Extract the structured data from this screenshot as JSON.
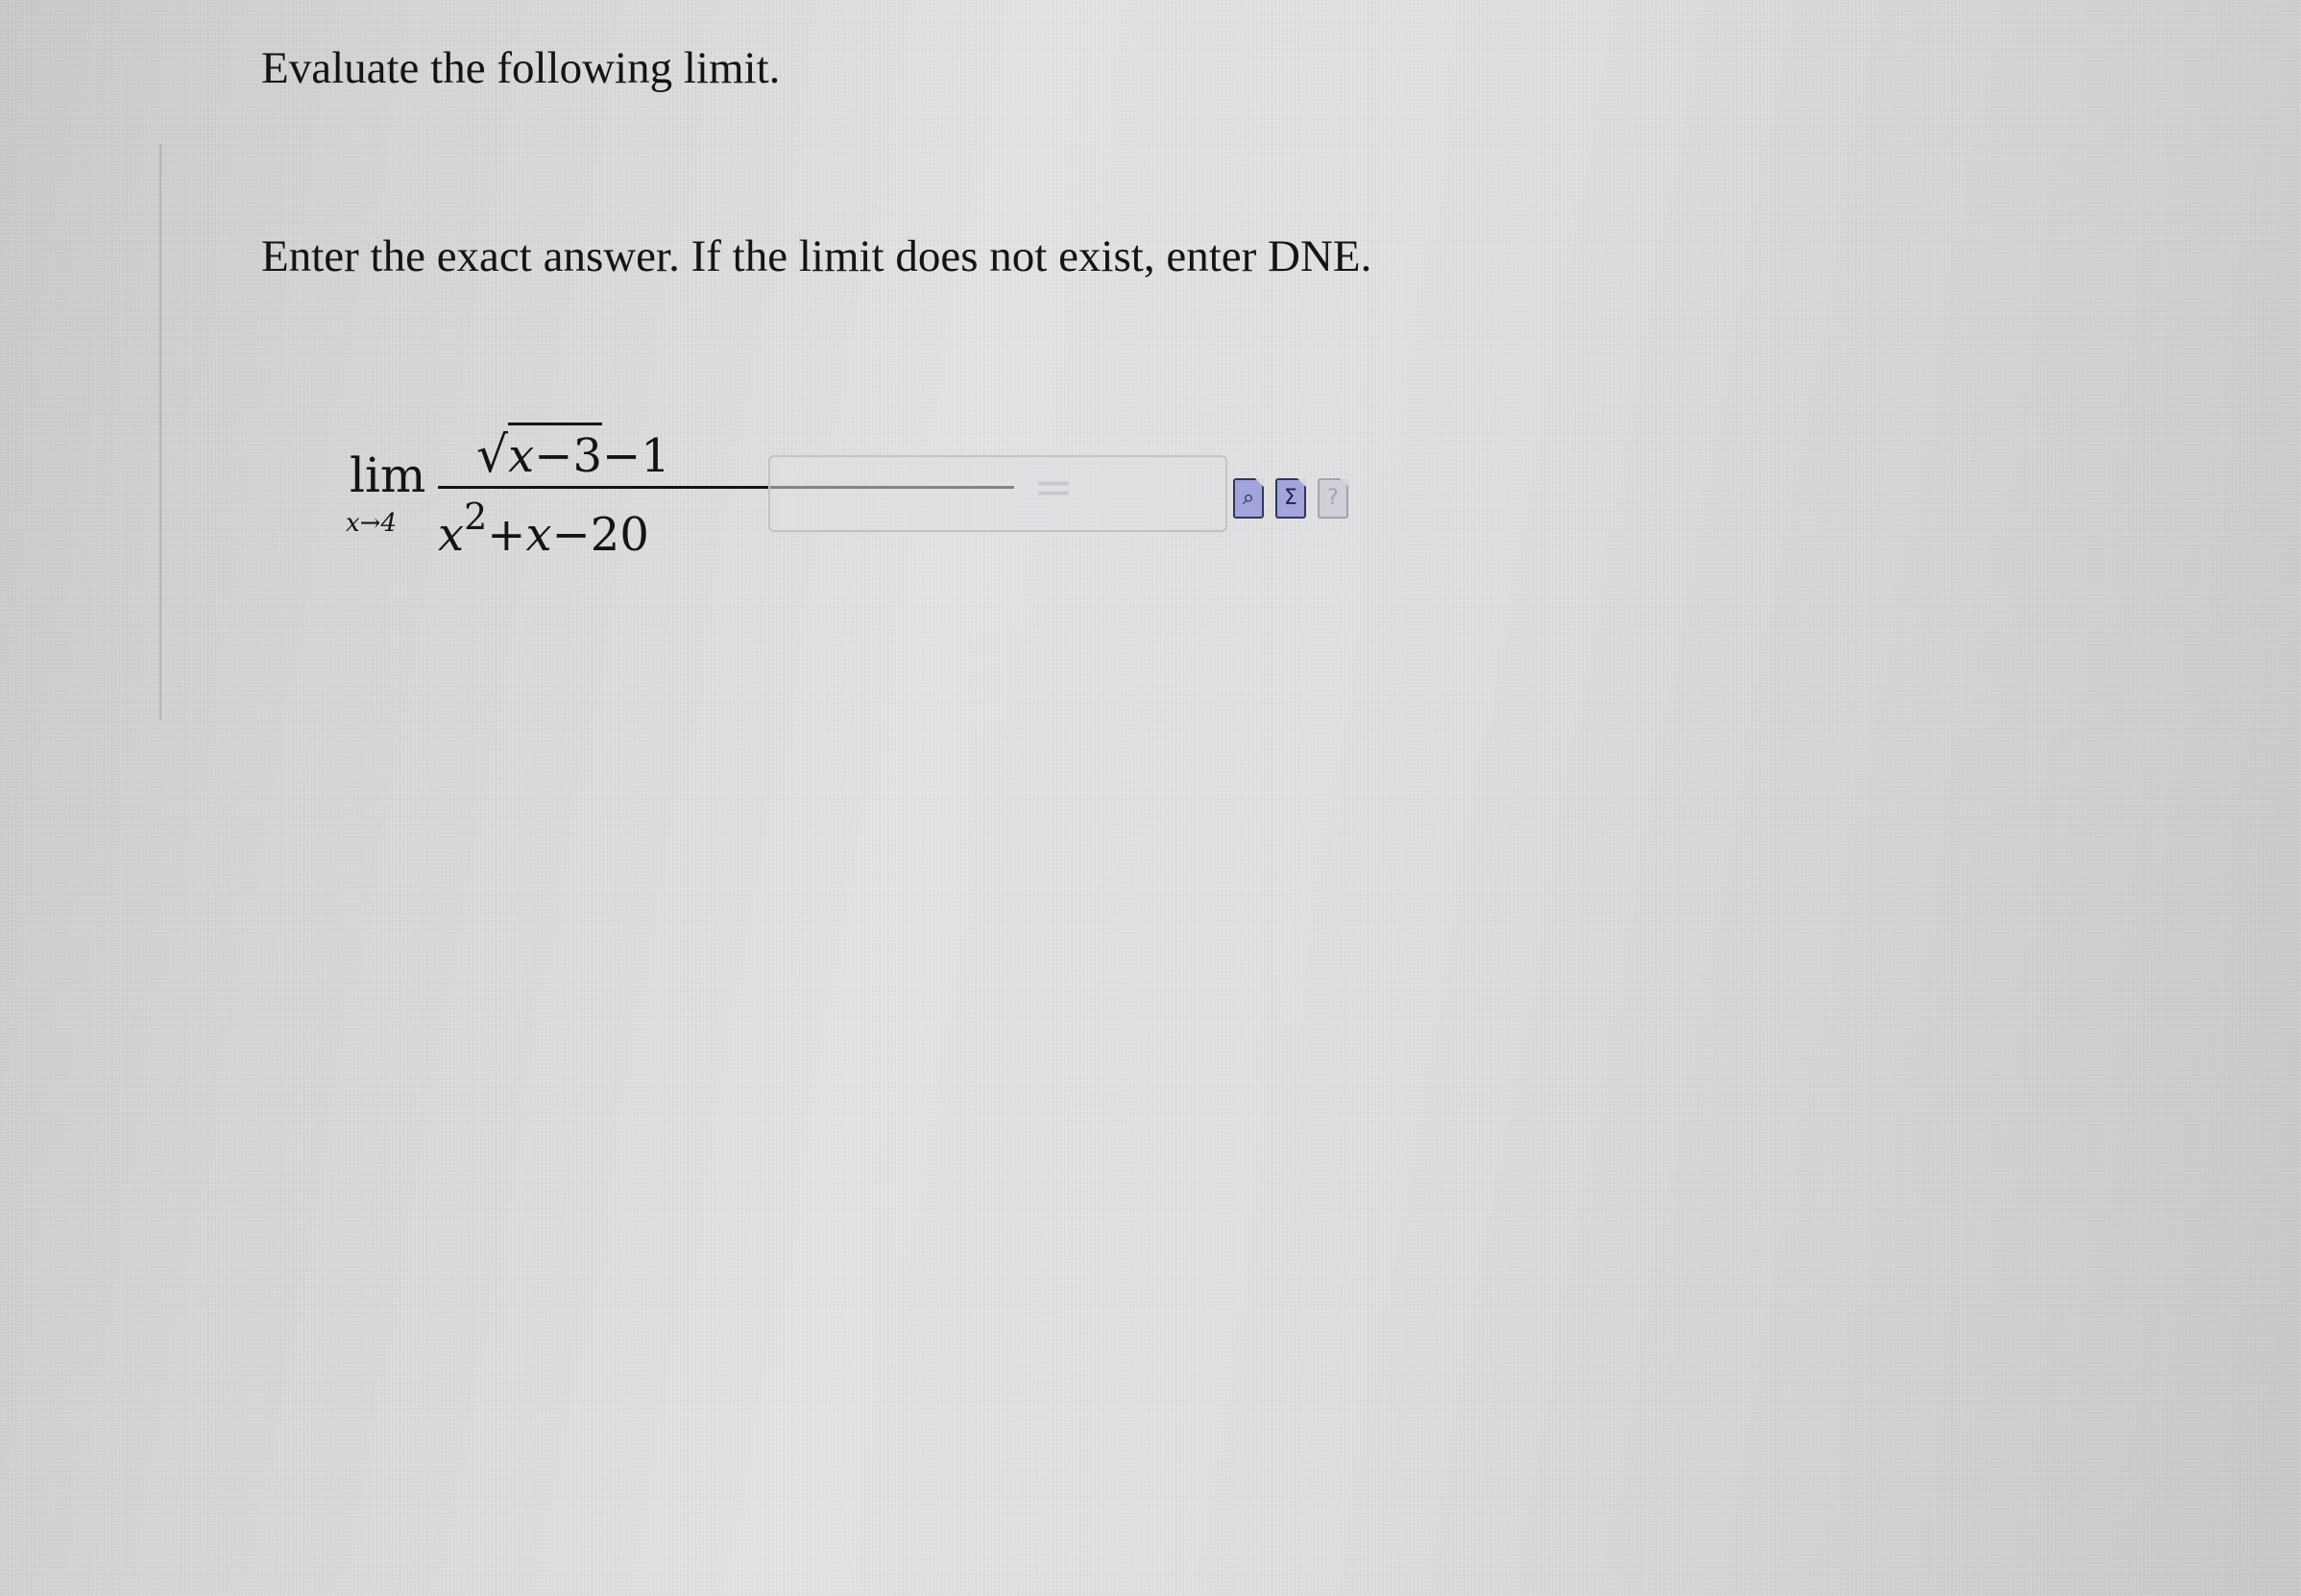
{
  "question": {
    "title": "Evaluate the following limit.",
    "instructions": "Enter the exact answer. If the limit does not exist, enter DNE.",
    "expression": {
      "operator": "lim",
      "subscript": "x→4",
      "numerator_sqrt_open": "√",
      "numerator_radicand_var": "x",
      "numerator_radicand_rest": "−3",
      "numerator_tail": "−1",
      "denominator_var": "x",
      "denominator_exp": "2",
      "denominator_rest_a": "+",
      "denominator_var2": "x",
      "denominator_rest_b": "−20",
      "equals": "="
    },
    "answer": {
      "value": "",
      "placeholder": ""
    },
    "tools": {
      "preview_icon": "magnifier-page-icon",
      "equation_editor_icon": "sigma-page-icon",
      "help_icon": "blank-page-icon",
      "preview_glyph": "⌕",
      "equation_glyph": "Σ",
      "help_glyph": "?"
    }
  }
}
